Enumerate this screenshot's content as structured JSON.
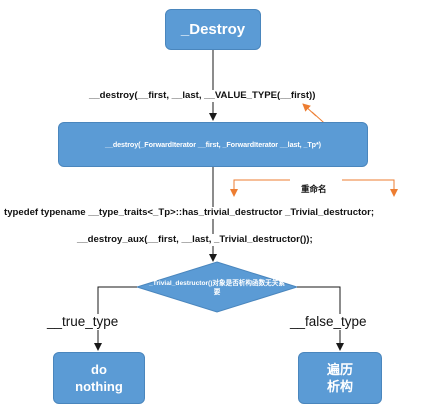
{
  "nodes": {
    "destroy": "_Destroy",
    "forward_iterator": "__destroy(_ForwardIterator __first, _ForwardIterator __last, _Tp*)",
    "condition": "_Trivial_destructor()对象是否析构函数无关紧要",
    "do_nothing": [
      "do",
      "nothing"
    ],
    "traverse_destruct": [
      "遍历",
      "析构"
    ]
  },
  "labels": {
    "call_destroy": "__destroy(__first, __last, __VALUE_TYPE(__first))",
    "typedef": "typedef typename __type_traits<_Tp>::has_trivial_destructor _Trivial_destructor;",
    "destroy_aux": "__destroy_aux(__first, __last, _Trivial_destructor());",
    "rename": "重命名",
    "true_type": "__true_type",
    "false_type": "__false_type"
  },
  "colors": {
    "box_fill": "#5b9bd5",
    "connector": "#1a1a1a",
    "annotation": "#ed7d31"
  }
}
